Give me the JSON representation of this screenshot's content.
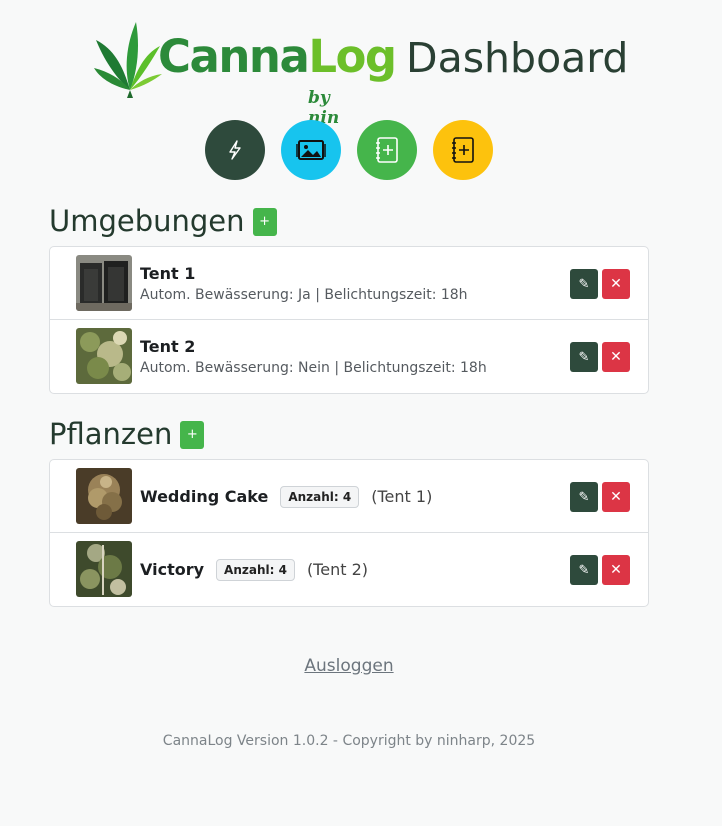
{
  "header": {
    "logo_text_a": "Canna",
    "logo_text_b": "Log",
    "logo_sub": "by nin",
    "title": "Dashboard"
  },
  "actions": [
    {
      "icon": "lightning-icon",
      "color": "#2e4a3c"
    },
    {
      "icon": "image-gallery-icon",
      "color": "#17c4ee"
    },
    {
      "icon": "add-note-icon",
      "color": "#45b54b"
    },
    {
      "icon": "add-notebook-icon",
      "color": "#fdc20d"
    }
  ],
  "environments": {
    "title": "Umgebungen",
    "add_label": "+",
    "items": [
      {
        "name": "Tent 1",
        "details": "Autom. Bewässerung: Ja | Belichtungszeit: 18h"
      },
      {
        "name": "Tent 2",
        "details": "Autom. Bewässerung: Nein | Belichtungszeit: 18h"
      }
    ]
  },
  "plants": {
    "title": "Pflanzen",
    "add_label": "+",
    "items": [
      {
        "name": "Wedding Cake",
        "count": "Anzahl: 4",
        "tent": "(Tent 1)"
      },
      {
        "name": "Victory",
        "count": "Anzahl: 4",
        "tent": "(Tent 2)"
      }
    ]
  },
  "row_actions": {
    "edit_label": "✎",
    "delete_label": "✕"
  },
  "logout_label": "Ausloggen",
  "footer": "CannaLog Version 1.0.2 - Copyright by ninharp, 2025",
  "colors": {
    "primary_dark": "#2e4a3c",
    "success": "#45b54b",
    "info": "#17c4ee",
    "warning": "#fdc20d",
    "danger": "#dc3545"
  }
}
